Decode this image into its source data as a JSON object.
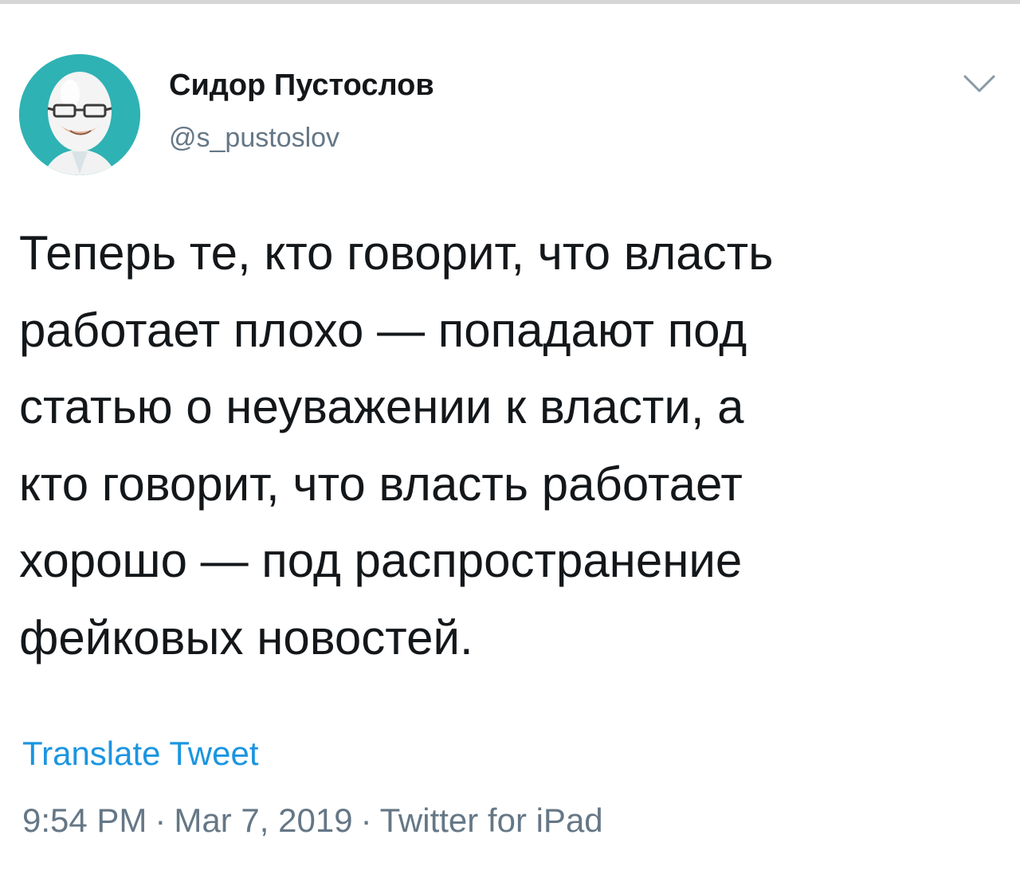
{
  "author": {
    "display_name": "Сидор Пустослов",
    "handle": "@s_pustoslov"
  },
  "tweet": {
    "lines": [
      "Теперь те, кто говорит, что власть",
      "работает плохо — попадают под",
      "статью о неуважении к власти, а",
      "кто говорит, что власть работает",
      "хорошо — под распространение",
      "фейковых новостей."
    ]
  },
  "actions": {
    "translate_label": "Translate Tweet"
  },
  "meta": {
    "time": "9:54 PM",
    "date": "Mar 7, 2019",
    "source": "Twitter for iPad",
    "separator": "·"
  },
  "colors": {
    "link": "#1b95e0",
    "secondary_text": "#657786",
    "primary_text": "#14171a",
    "avatar_background": "#2fb2b4"
  },
  "icons": {
    "menu": "chevron-down-icon",
    "avatar": "egg-face-avatar"
  }
}
